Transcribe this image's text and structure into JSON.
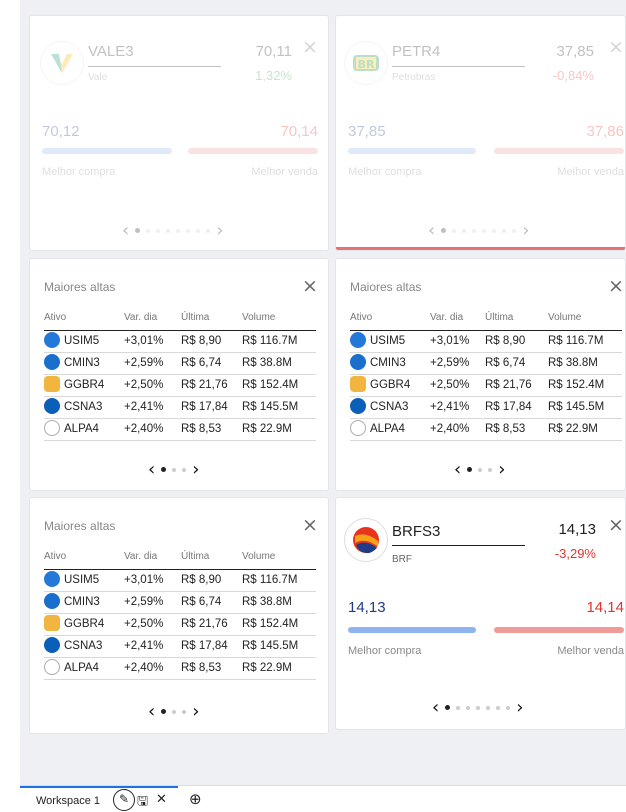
{
  "quotes": [
    {
      "ticker": "VALE3",
      "name": "Vale",
      "price": "70,11",
      "pct": "1,32%",
      "bid": "70,12",
      "ask": "70,14",
      "bid_label": "Melhor compra",
      "ask_label": "Melhor venda",
      "pct_color": "#27a744"
    },
    {
      "ticker": "PETR4",
      "name": "Petrobras",
      "price": "37,85",
      "pct": "-0,84%",
      "bid": "37,85",
      "ask": "37,86",
      "bid_label": "Melhor compra",
      "ask_label": "Melhor venda",
      "pct_color": "#e2342f"
    },
    {
      "ticker": "BRFS3",
      "name": "BRF",
      "price": "14,13",
      "pct": "-3,29%",
      "bid": "14,13",
      "ask": "14,14",
      "bid_label": "Melhor compra",
      "ask_label": "Melhor venda",
      "pct_color": "#e2342f"
    }
  ],
  "gainers": {
    "title": "Maiores altas",
    "headers": [
      "Ativo",
      "Var. dia",
      "Última",
      "Volume"
    ],
    "rows": [
      {
        "ticker": "USIM5",
        "var": "+3,01%",
        "last": "R$ 8,90",
        "volume": "R$ 116.7M"
      },
      {
        "ticker": "CMIN3",
        "var": "+2,59%",
        "last": "R$ 6,74",
        "volume": "R$ 38.8M"
      },
      {
        "ticker": "GGBR4",
        "var": "+2,50%",
        "last": "R$ 21,76",
        "volume": "R$ 152.4M"
      },
      {
        "ticker": "CSNA3",
        "var": "+2,41%",
        "last": "R$ 17,84",
        "volume": "R$ 145.5M"
      },
      {
        "ticker": "ALPA4",
        "var": "+2,40%",
        "last": "R$ 8,53",
        "volume": "R$ 22.9M"
      }
    ]
  },
  "logos": {
    "petrobras": "BR"
  },
  "close_icon": "×",
  "tabs": {
    "workspace_label": "Workspace 1"
  },
  "colors": {
    "bid_bar": "#8fb4f0",
    "ask_bar": "#f09a9a",
    "positive": "#27a744",
    "negative": "#e2342f",
    "accent": "#1a73e8"
  }
}
